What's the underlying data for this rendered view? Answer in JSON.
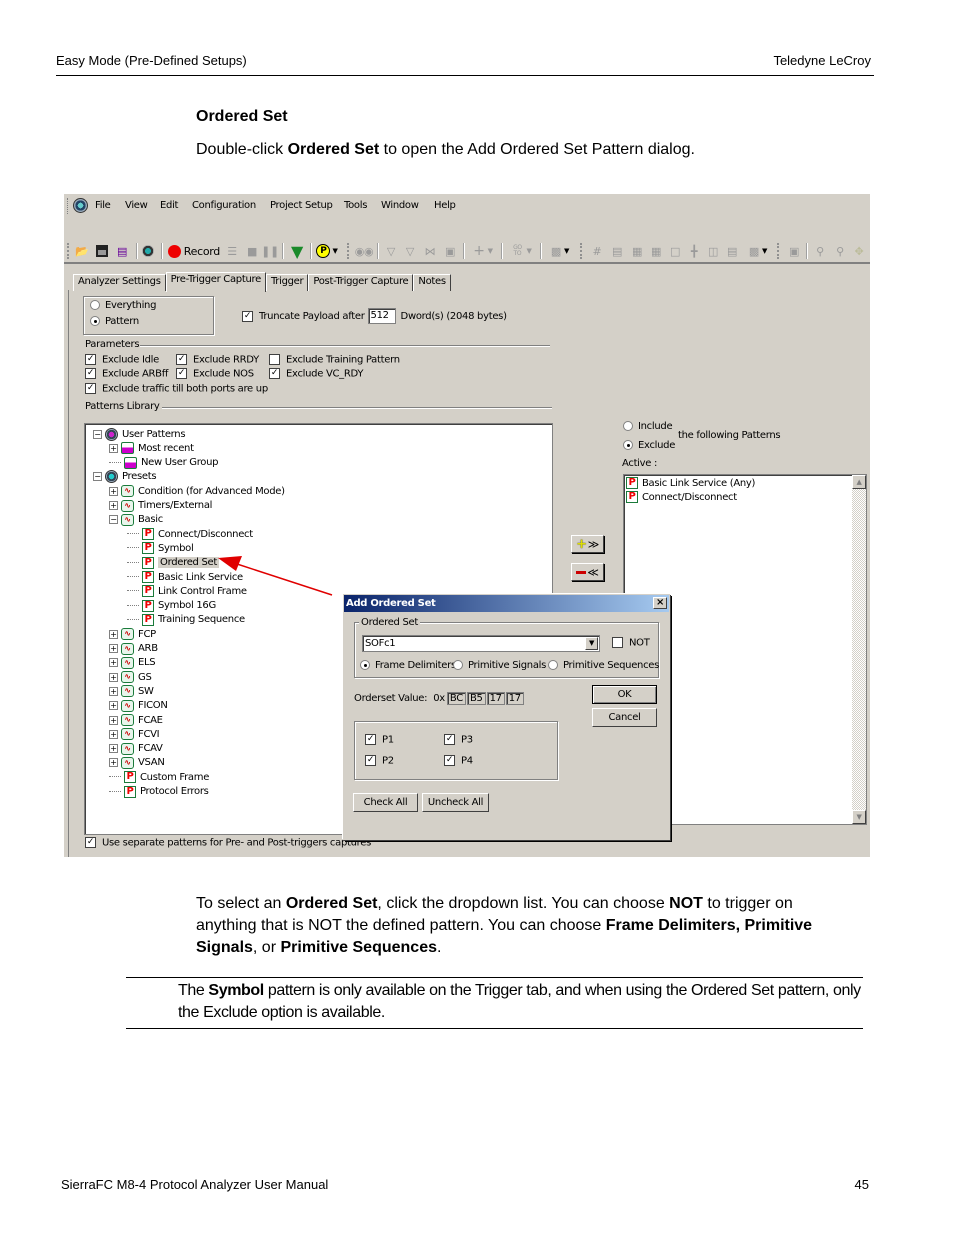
{
  "page_header": {
    "left": "Easy Mode (Pre-Defined Setups)",
    "right": "Teledyne  LeCroy"
  },
  "section_title": "Ordered Set",
  "intro": {
    "prefix": "Double-click ",
    "bold": "Ordered Set",
    "suffix": " to open the Add Ordered Set Pattern dialog."
  },
  "app": {
    "menu": [
      "File",
      "View",
      "Edit",
      "Configuration",
      "Project Setup",
      "Tools",
      "Window",
      "Help"
    ],
    "toolbar": {
      "record_label": "Record",
      "icons": [
        "open-folder-icon",
        "save-icon",
        "report-icon",
        "analyzer-icon",
        "record-icon",
        "stack-icon",
        "stop-icon",
        "pause-icon",
        "trigger-icon",
        "pattern-icon",
        "find-icon",
        "filter-icon",
        "filter-off-icon",
        "hide-icon",
        "view-icon",
        "add-icon",
        "goto-icon",
        "bookmark-icon",
        "grid-icon",
        "search-report-icon",
        "table-icon",
        "calc-icon",
        "note-icon",
        "tree-icon",
        "split-icon",
        "link-icon",
        "layout-icon",
        "window-icon",
        "zoom-in-icon",
        "zoom-out-icon",
        "pan-icon"
      ],
      "goto_label": "GO TO"
    },
    "tabs": [
      {
        "label": "Analyzer Settings",
        "active": false
      },
      {
        "label": "Pre-Trigger Capture",
        "active": true
      },
      {
        "label": "Trigger",
        "active": false
      },
      {
        "label": "Post-Trigger Capture",
        "active": false
      },
      {
        "label": "Notes",
        "active": false
      }
    ],
    "capture_mode": {
      "options": [
        "Everything",
        "Pattern"
      ],
      "selected": "Pattern"
    },
    "truncate": {
      "label": "Truncate Payload after",
      "checked": true,
      "value": "512",
      "unit": "Dword(s)  (2048 bytes)"
    },
    "parameters": {
      "title": "Parameters",
      "items": [
        {
          "label": "Exclude Idle",
          "checked": true
        },
        {
          "label": "Exclude RRDY",
          "checked": true
        },
        {
          "label": "Exclude Training Pattern",
          "checked": false
        },
        {
          "label": "Exclude ARBff",
          "checked": true
        },
        {
          "label": "Exclude NOS",
          "checked": true
        },
        {
          "label": "Exclude VC_RDY",
          "checked": true
        },
        {
          "label": "Exclude traffic till both ports are up",
          "checked": true
        }
      ]
    },
    "patterns_library_title": "Patterns Library",
    "tree": [
      {
        "label": "User Patterns",
        "level": 0,
        "expander": "minus",
        "icon": "globe-icon"
      },
      {
        "label": "Most recent",
        "level": 1,
        "expander": "plus",
        "icon": "user-group-icon"
      },
      {
        "label": "New User Group",
        "level": 1,
        "expander": "none",
        "icon": "user-group-icon"
      },
      {
        "label": "Presets",
        "level": 0,
        "expander": "minus",
        "icon": "globe-icon"
      },
      {
        "label": "Condition (for Advanced Mode)",
        "level": 1,
        "expander": "plus",
        "icon": "waveform-icon"
      },
      {
        "label": "Timers/External",
        "level": 1,
        "expander": "plus",
        "icon": "waveform-icon"
      },
      {
        "label": "Basic",
        "level": 1,
        "expander": "minus",
        "icon": "waveform-icon"
      },
      {
        "label": "Connect/Disconnect",
        "level": 2,
        "expander": "none",
        "icon": "pattern-p-icon"
      },
      {
        "label": "Symbol",
        "level": 2,
        "expander": "none",
        "icon": "pattern-p-icon"
      },
      {
        "label": "Ordered Set",
        "level": 2,
        "expander": "none",
        "icon": "pattern-p-icon",
        "selected": true
      },
      {
        "label": "Basic Link Service",
        "level": 2,
        "expander": "none",
        "icon": "pattern-p-icon"
      },
      {
        "label": "Link Control Frame",
        "level": 2,
        "expander": "none",
        "icon": "pattern-p-icon"
      },
      {
        "label": "Symbol 16G",
        "level": 2,
        "expander": "none",
        "icon": "pattern-p-icon"
      },
      {
        "label": "Training Sequence",
        "level": 2,
        "expander": "none",
        "icon": "pattern-p-icon"
      },
      {
        "label": "FCP",
        "level": 1,
        "expander": "plus",
        "icon": "waveform-icon"
      },
      {
        "label": "ARB",
        "level": 1,
        "expander": "plus",
        "icon": "waveform-icon"
      },
      {
        "label": "ELS",
        "level": 1,
        "expander": "plus",
        "icon": "waveform-icon"
      },
      {
        "label": "GS",
        "level": 1,
        "expander": "plus",
        "icon": "waveform-icon"
      },
      {
        "label": "SW",
        "level": 1,
        "expander": "plus",
        "icon": "waveform-icon"
      },
      {
        "label": "FICON",
        "level": 1,
        "expander": "plus",
        "icon": "waveform-icon"
      },
      {
        "label": "FCAE",
        "level": 1,
        "expander": "plus",
        "icon": "waveform-icon"
      },
      {
        "label": "FCVI",
        "level": 1,
        "expander": "plus",
        "icon": "waveform-icon"
      },
      {
        "label": "FCAV",
        "level": 1,
        "expander": "plus",
        "icon": "waveform-icon"
      },
      {
        "label": "VSAN",
        "level": 1,
        "expander": "plus",
        "icon": "waveform-icon"
      },
      {
        "label": "Custom Frame",
        "level": 1,
        "expander": "none",
        "icon": "pattern-p-icon"
      },
      {
        "label": "Protocol Errors",
        "level": 1,
        "expander": "none",
        "icon": "pattern-p-icon"
      }
    ],
    "include_exclude": {
      "options": [
        "Include",
        "Exclude"
      ],
      "selected": "Exclude",
      "suffix": "the following Patterns"
    },
    "active_label": "Active :",
    "active_list": [
      "Basic Link Service (Any)",
      "Connect/Disconnect"
    ],
    "add_button": "+>>",
    "remove_button": "–<<",
    "separate_patterns": {
      "label": "Use separate patterns for Pre- and Post-triggers captures",
      "checked": true
    }
  },
  "dialog": {
    "title": "Add Ordered Set",
    "group_title": "Ordered Set",
    "selected_value": "SOFc1",
    "not_label": "NOT",
    "not_checked": false,
    "types": [
      "Frame Delimiters",
      "Primitive Signals",
      "Primitive Sequences"
    ],
    "selected_type": "Frame Delimiters",
    "orderset_label": "Orderset Value:",
    "hex_prefix": "0x",
    "hex_bytes": [
      "BC",
      "B5",
      "17",
      "17"
    ],
    "ok_label": "OK",
    "cancel_label": "Cancel",
    "ports": [
      {
        "label": "P1",
        "checked": true
      },
      {
        "label": "P3",
        "checked": true
      },
      {
        "label": "P2",
        "checked": true
      },
      {
        "label": "P4",
        "checked": true
      }
    ],
    "check_all_label": "Check All",
    "uncheck_all_label": "Uncheck All"
  },
  "body_paragraph": {
    "p1": "To select an ",
    "b1": "Ordered Set",
    "p2": ", click the dropdown list. You can choose ",
    "b2": "NOT",
    "p3": " to trigger on anything that is NOT the defined pattern. You can choose ",
    "b3": "Frame Delimiters, Primitive Signals",
    "p4": ", or ",
    "b4": "Primitive Sequences",
    "p5": "."
  },
  "note": {
    "p1": "The ",
    "b1": "Symbol",
    "p2": " pattern is only available on the Trigger tab, and when using the Ordered Set pattern, only the Exclude option is available."
  },
  "page_footer": {
    "left": "SierraFC M8-4 Protocol Analyzer User Manual",
    "right": "45"
  },
  "colors": {
    "window_bg": "#d4d0c8",
    "title_bar": "#0a246a",
    "arrow": "#e00000",
    "selection": "#d4d0c8"
  }
}
